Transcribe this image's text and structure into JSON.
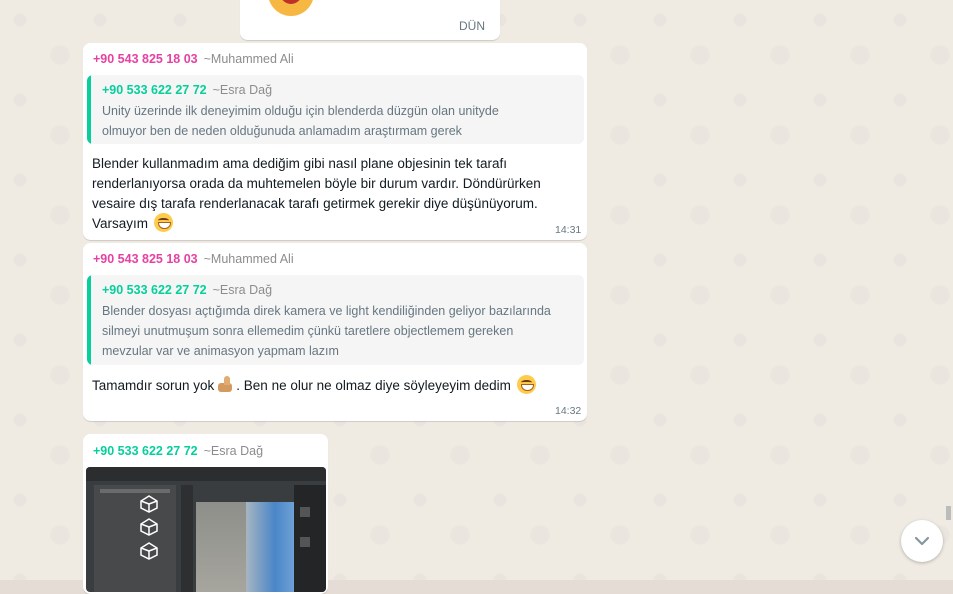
{
  "chat": {
    "first_bubble": {
      "time": "DÜN"
    },
    "messages": [
      {
        "sender_number": "+90 543 825 18 03",
        "sender_name": "~Muhammed Ali",
        "quote": {
          "number": "+90 533 622 27 72",
          "name": "~Esra Dağ",
          "lines": [
            "Unity üzerinde ilk deneyimim olduğu için blenderda düzgün olan unityde",
            "olmuyor ben de neden olduğunuda anlamadım araştırmam gerek"
          ]
        },
        "lines": [
          "Blender kullanmadım ama dediğim gibi nasıl plane objesinin tek tarafı",
          "renderlanıyorsa orada da muhtemelen böyle bir durum vardır. Döndürürken",
          "vesaire dış tarafa renderlanacak tarafı getirmek gerekir diye düşünüyorum.",
          "Varsayım"
        ],
        "time": "14:31"
      },
      {
        "sender_number": "+90 543 825 18 03",
        "sender_name": "~Muhammed Ali",
        "quote": {
          "number": "+90 533 622 27 72",
          "name": "~Esra Dağ",
          "lines": [
            "Blender dosyası açtığımda direk kamera ve light kendiliğinden geliyor bazılarında",
            "silmeyi unutmuşum sonra ellemedim çünkü taretlere objectlemem gereken",
            "mevzular var ve animasyon yapmam lazım"
          ]
        },
        "text_a": "Tamamdır sorun yok",
        "text_b": ". Ben ne olur ne olmaz diye söyleyeyim dedim",
        "time": "14:32"
      },
      {
        "sender_number": "+90 533 622 27 72",
        "sender_name": "~Esra Dağ",
        "attachment": "image"
      }
    ]
  },
  "colors": {
    "muhammed": "#e542a3",
    "esra": "#06cf9c",
    "bubble": "#ffffff",
    "wallpaper": "#efeae2"
  },
  "icons": {
    "grin": "grinning-emoji-icon",
    "thumbs": "thumbs-up-emoji-icon",
    "scroll": "chevron-down-icon"
  }
}
